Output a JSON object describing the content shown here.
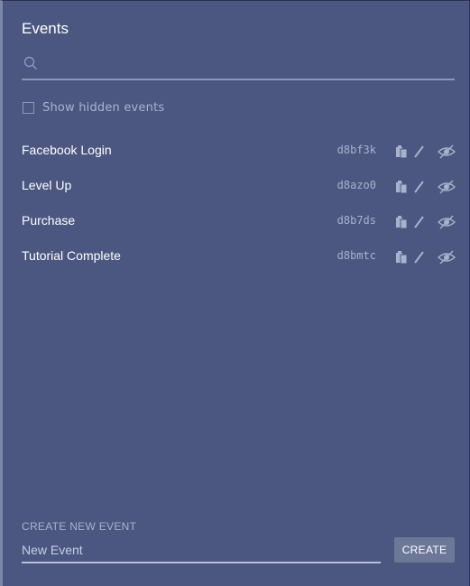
{
  "panel": {
    "title": "Events"
  },
  "search": {
    "value": "",
    "placeholder": ""
  },
  "hidden_toggle": {
    "label": "Show hidden events",
    "checked": false
  },
  "events": [
    {
      "name": "Facebook Login",
      "id": "d8bf3k"
    },
    {
      "name": "Level Up",
      "id": "d8azo0"
    },
    {
      "name": "Purchase",
      "id": "d8b7ds"
    },
    {
      "name": "Tutorial Complete",
      "id": "d8bmtc"
    }
  ],
  "row_icons": [
    "clipboard-icon",
    "pencil-icon",
    "eye-icon"
  ],
  "create": {
    "section_label": "CREATE NEW EVENT",
    "input_placeholder": "New Event",
    "input_value": "",
    "button_label": "CREATE"
  },
  "colors": {
    "background": "#4b5780",
    "accent_border": "#7d87a8",
    "muted_text": "#a9b1cc",
    "button": "#6d7899"
  }
}
